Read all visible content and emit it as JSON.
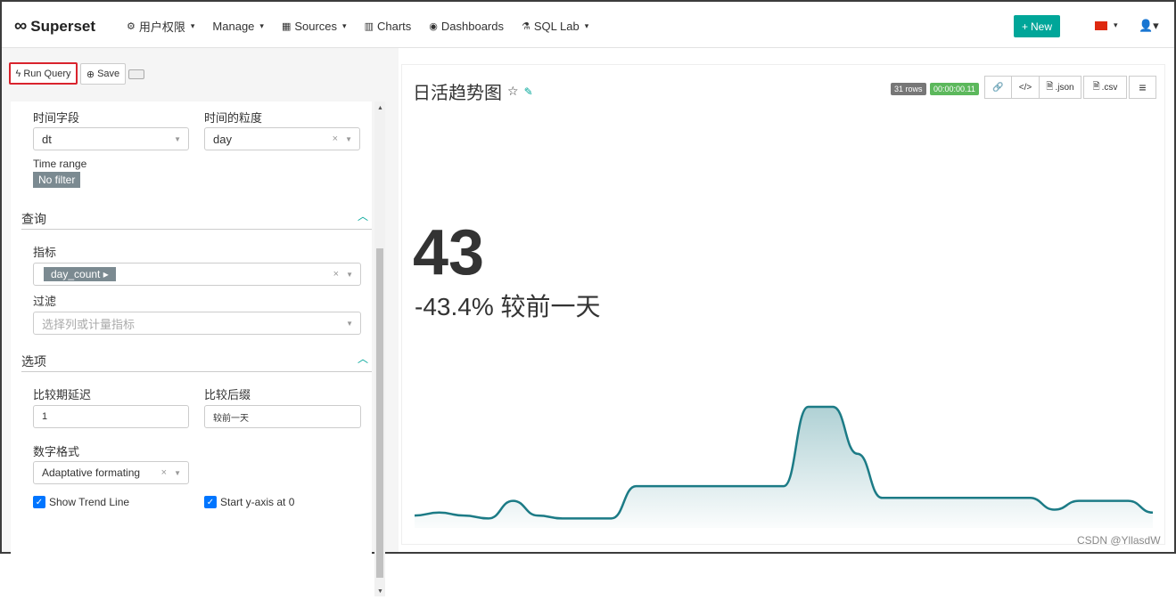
{
  "app": {
    "name": "Superset",
    "logo": "∞"
  },
  "nav": {
    "items": [
      {
        "icon": "gears-icon",
        "label": "用户权限",
        "caret": true
      },
      {
        "icon": "",
        "label": "Manage",
        "caret": true
      },
      {
        "icon": "table-icon",
        "label": "Sources",
        "caret": true
      },
      {
        "icon": "bar-chart-icon",
        "label": "Charts",
        "caret": false
      },
      {
        "icon": "dashboard-icon",
        "label": "Dashboards",
        "caret": false
      },
      {
        "icon": "flask-icon",
        "label": "SQL Lab",
        "caret": true
      }
    ],
    "new_label": "New"
  },
  "toolbar": {
    "run_label": "Run Query",
    "save_label": "Save"
  },
  "controls": {
    "time_column_label": "时间字段",
    "time_column_value": "dt",
    "granularity_label": "时间的粒度",
    "granularity_value": "day",
    "time_range_label": "Time range",
    "time_range_value": "No filter",
    "query_section": "查询",
    "metric_label": "指标",
    "metric_value": "day_count",
    "filter_label": "过滤",
    "filter_placeholder": "选择列或计量指标",
    "options_section": "选项",
    "compare_lag_label": "比较期延迟",
    "compare_lag_value": "1",
    "compare_suffix_label": "比较后缀",
    "compare_suffix_value": "较前一天",
    "number_format_label": "数字格式",
    "number_format_value": "Adaptative formating",
    "show_trend_label": "Show Trend Line",
    "start_y_zero_label": "Start y-axis at 0"
  },
  "chart": {
    "title": "日活趋势图",
    "rows_badge": "31 rows",
    "time_badge": "00:00:00.11",
    "json_label": ".json",
    "csv_label": ".csv",
    "big_number": "43",
    "subheader": "-43.4% 较前一天",
    "accent": "#1c7b86"
  },
  "chart_data": {
    "type": "area",
    "values": [
      3,
      4,
      3,
      2,
      8,
      3,
      2,
      2,
      2,
      13,
      13,
      13,
      13,
      13,
      13,
      13,
      40,
      40,
      24,
      9,
      9,
      9,
      9,
      9,
      9,
      9,
      5,
      8,
      8,
      8,
      4
    ]
  },
  "watermark": "CSDN @YllasdW"
}
